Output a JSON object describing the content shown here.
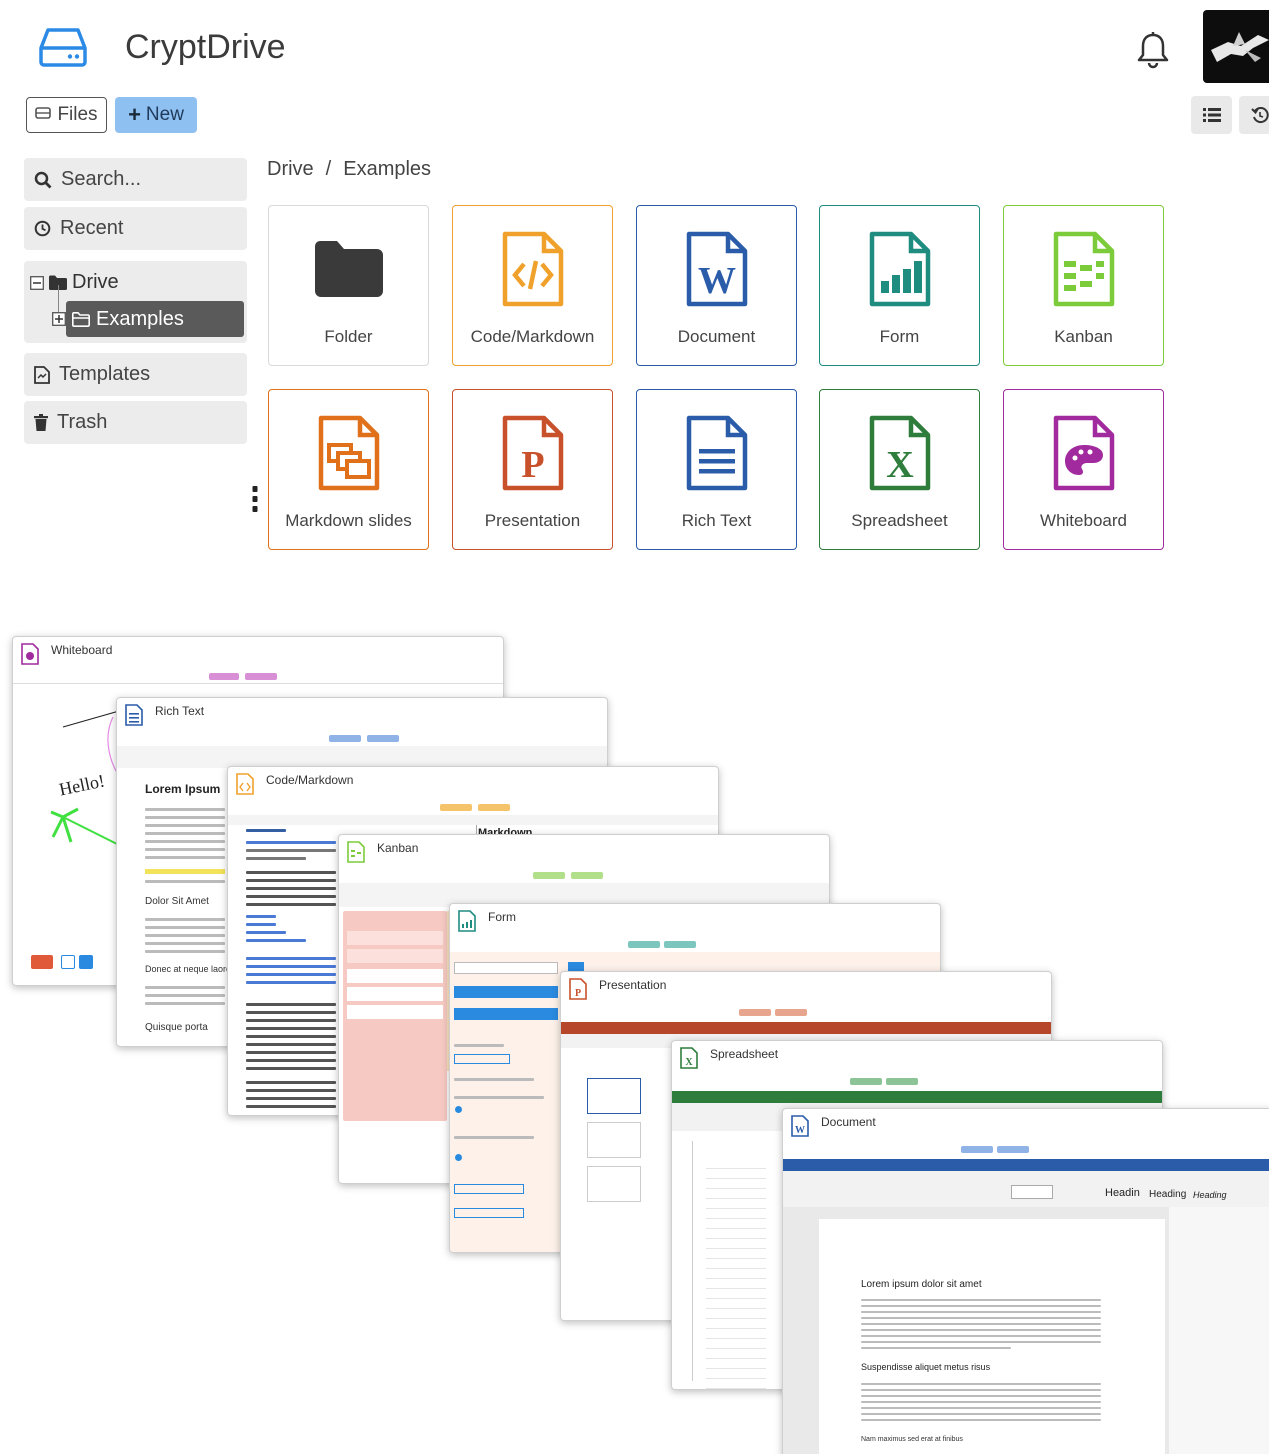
{
  "header": {
    "app_title": "CryptDrive"
  },
  "toolbar": {
    "files_label": "Files",
    "new_label": "New"
  },
  "sidebar": {
    "search_placeholder": "Search...",
    "recent_label": "Recent",
    "drive_label": "Drive",
    "examples_label": "Examples",
    "templates_label": "Templates",
    "trash_label": "Trash"
  },
  "breadcrumb": {
    "root": "Drive",
    "separator": "/",
    "current": "Examples"
  },
  "cards": [
    {
      "label": "Folder",
      "icon": "folder-icon",
      "color": "#3a3a3a",
      "border": "#d9d9d9"
    },
    {
      "label": "Code/Markdown",
      "icon": "code-file-icon",
      "color": "#f0a12b",
      "border": "#f0a12b"
    },
    {
      "label": "Document",
      "icon": "word-document-icon",
      "color": "#2a5caa",
      "border": "#2a5caa"
    },
    {
      "label": "Form",
      "icon": "form-chart-icon",
      "color": "#1f8c80",
      "border": "#1f8c80"
    },
    {
      "label": "Kanban",
      "icon": "kanban-icon",
      "color": "#7ccb3a",
      "border": "#7ccb3a"
    },
    {
      "label": "Markdown slides",
      "icon": "slides-icon",
      "color": "#e0701a",
      "border": "#e0701a"
    },
    {
      "label": "Presentation",
      "icon": "presentation-icon",
      "color": "#c8502a",
      "border": "#c8502a"
    },
    {
      "label": "Rich Text",
      "icon": "rich-text-icon",
      "color": "#2a5caa",
      "border": "#2a5caa"
    },
    {
      "label": "Spreadsheet",
      "icon": "spreadsheet-icon",
      "color": "#2f7d3c",
      "border": "#2f7d3c"
    },
    {
      "label": "Whiteboard",
      "icon": "palette-icon",
      "color": "#a12b9e",
      "border": "#a12b9e"
    }
  ],
  "collage": {
    "windows": [
      {
        "title": "Whiteboard"
      },
      {
        "title": "Rich Text"
      },
      {
        "title": "Code/Markdown"
      },
      {
        "title": "Kanban"
      },
      {
        "title": "Form"
      },
      {
        "title": "Presentation"
      },
      {
        "title": "Spreadsheet"
      },
      {
        "title": "Document"
      }
    ],
    "whiteboard_text": "Hello!",
    "richtext_heading": "Lorem Ipsum",
    "richtext_sub1": "Dolor Sit Amet",
    "richtext_sub2": "Donec at neque laore",
    "richtext_sub3": "Quisque porta",
    "code_preview_heading": "Markdown",
    "document_heading": "Lorem ipsum dolor sit amet",
    "document_subheading": "Suspendisse aliquet metus risus",
    "document_footer": "Nam maximus sed erat at finibus",
    "document_style1": "Headin",
    "document_style2": "Heading",
    "document_style3": "Heading"
  }
}
